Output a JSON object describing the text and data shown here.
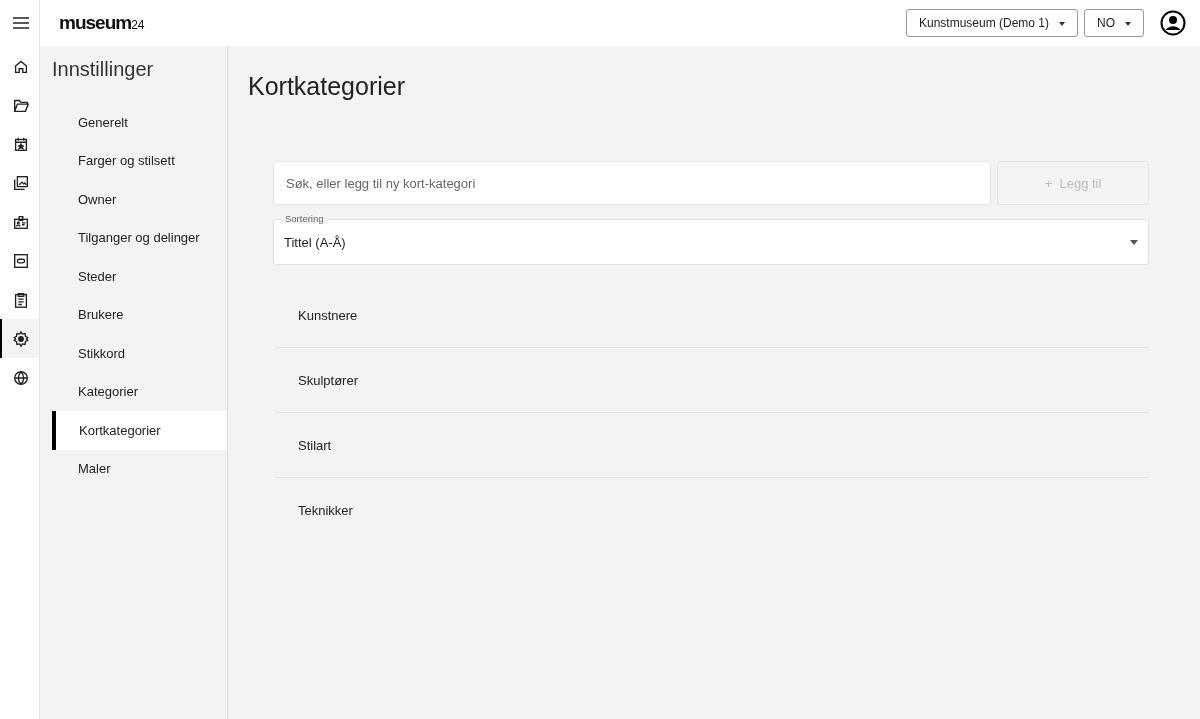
{
  "logo": {
    "name": "museum",
    "suffix": "24"
  },
  "rail": [
    {
      "kind": "home",
      "selected": false
    },
    {
      "kind": "folder",
      "selected": false
    },
    {
      "kind": "calendar",
      "selected": false
    },
    {
      "kind": "images",
      "selected": false
    },
    {
      "kind": "badge",
      "selected": false
    },
    {
      "kind": "tag",
      "selected": false
    },
    {
      "kind": "clipboard",
      "selected": false
    },
    {
      "kind": "gear",
      "selected": true
    },
    {
      "kind": "globe",
      "selected": false
    }
  ],
  "topbar": {
    "museum_select": "Kunstmuseum (Demo 1)",
    "language_select": "NO"
  },
  "settings": {
    "title": "Innstillinger",
    "items": [
      {
        "label": "Generelt",
        "selected": false
      },
      {
        "label": "Farger og stilsett",
        "selected": false
      },
      {
        "label": "Owner",
        "selected": false
      },
      {
        "label": "Tilganger og delinger",
        "selected": false
      },
      {
        "label": "Steder",
        "selected": false
      },
      {
        "label": "Brukere",
        "selected": false
      },
      {
        "label": "Stikkord",
        "selected": false
      },
      {
        "label": "Kategorier",
        "selected": false
      },
      {
        "label": "Kortkategorier",
        "selected": true
      },
      {
        "label": "Maler",
        "selected": false
      }
    ]
  },
  "content": {
    "title": "Kortkategorier",
    "search": {
      "placeholder": "Søk, eller legg til ny kort-kategori"
    },
    "add_button": {
      "icon": "+",
      "label": "Legg til",
      "disabled": true
    },
    "sort": {
      "label": "Sortering",
      "value": "Tittel (A-Å)"
    },
    "categories": [
      "Kunstnere",
      "Skulptører",
      "Stilart",
      "Teknikker"
    ]
  }
}
